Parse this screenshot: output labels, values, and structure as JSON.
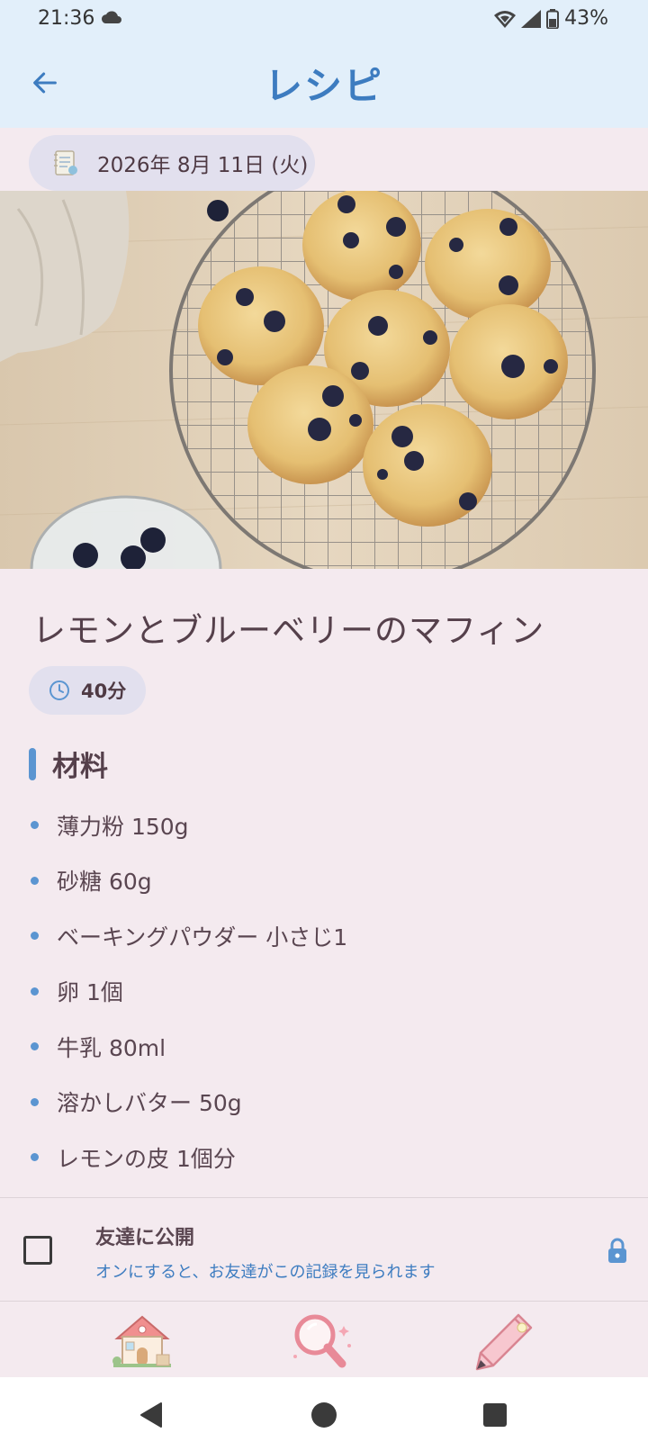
{
  "status_bar": {
    "time": "21:36",
    "battery": "43%",
    "icons": [
      "cloud-icon",
      "wifi-icon",
      "signal-icon",
      "battery-icon"
    ]
  },
  "app_bar": {
    "title": "レシピ",
    "back_icon": "arrow-back-icon"
  },
  "entry": {
    "date": "2026年 8月 11日 (火)",
    "date_icon": "diary-icon"
  },
  "recipe": {
    "title": "レモンとブルーベリーのマフィン",
    "time": "40分",
    "time_icon": "clock-icon",
    "ingredients_heading": "材料",
    "ingredients": [
      "薄力粉 150g",
      "砂糖 60g",
      "ベーキングパウダー 小さじ1",
      "卵 1個",
      "牛乳 80ml",
      "溶かしバター 50g",
      "レモンの皮 1個分"
    ]
  },
  "share": {
    "title": "友達に公開",
    "subtitle": "オンにすると、お友達がこの記録を見られます",
    "checked": false
  },
  "bottom_nav": {
    "items": [
      "home-icon",
      "search-icon",
      "pencil-icon"
    ]
  },
  "system_nav": {
    "items": [
      "back-triangle-icon",
      "home-circle-icon",
      "recents-square-icon"
    ]
  },
  "colors": {
    "accent": "#3d7cc0",
    "bullet": "#5b95d1",
    "top_bar": "#e2effa",
    "background": "#f4eaef",
    "chip": "#e2e0ee"
  }
}
